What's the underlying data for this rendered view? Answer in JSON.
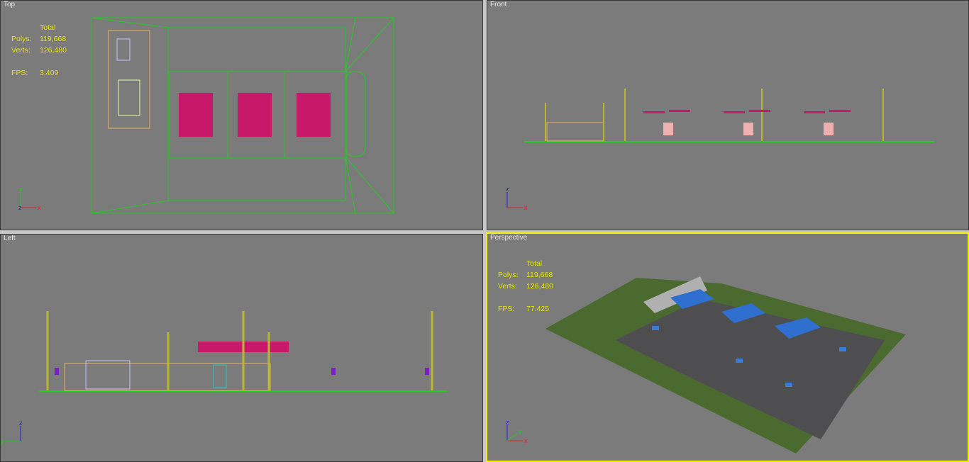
{
  "viewports": {
    "top": {
      "label": "Top"
    },
    "front": {
      "label": "Front"
    },
    "left": {
      "label": "Left"
    },
    "perspective": {
      "label": "Perspective"
    }
  },
  "stats_top": {
    "total": "Total",
    "polys_label": "Polys:",
    "polys": "119,668",
    "verts_label": "Verts:",
    "verts": "126,480",
    "fps_label": "FPS:",
    "fps": "3.409"
  },
  "stats_persp": {
    "total": "Total",
    "polys_label": "Polys:",
    "polys": "119,668",
    "verts_label": "Verts:",
    "verts": "126,480",
    "fps_label": "FPS:",
    "fps": "77.425"
  },
  "axes": {
    "x": "x",
    "y": "y",
    "z": "z"
  },
  "colors": {
    "background": "#7b7b7b",
    "wire": "#22cc22",
    "stats": "#e6e600",
    "active_border": "#f0f000"
  }
}
